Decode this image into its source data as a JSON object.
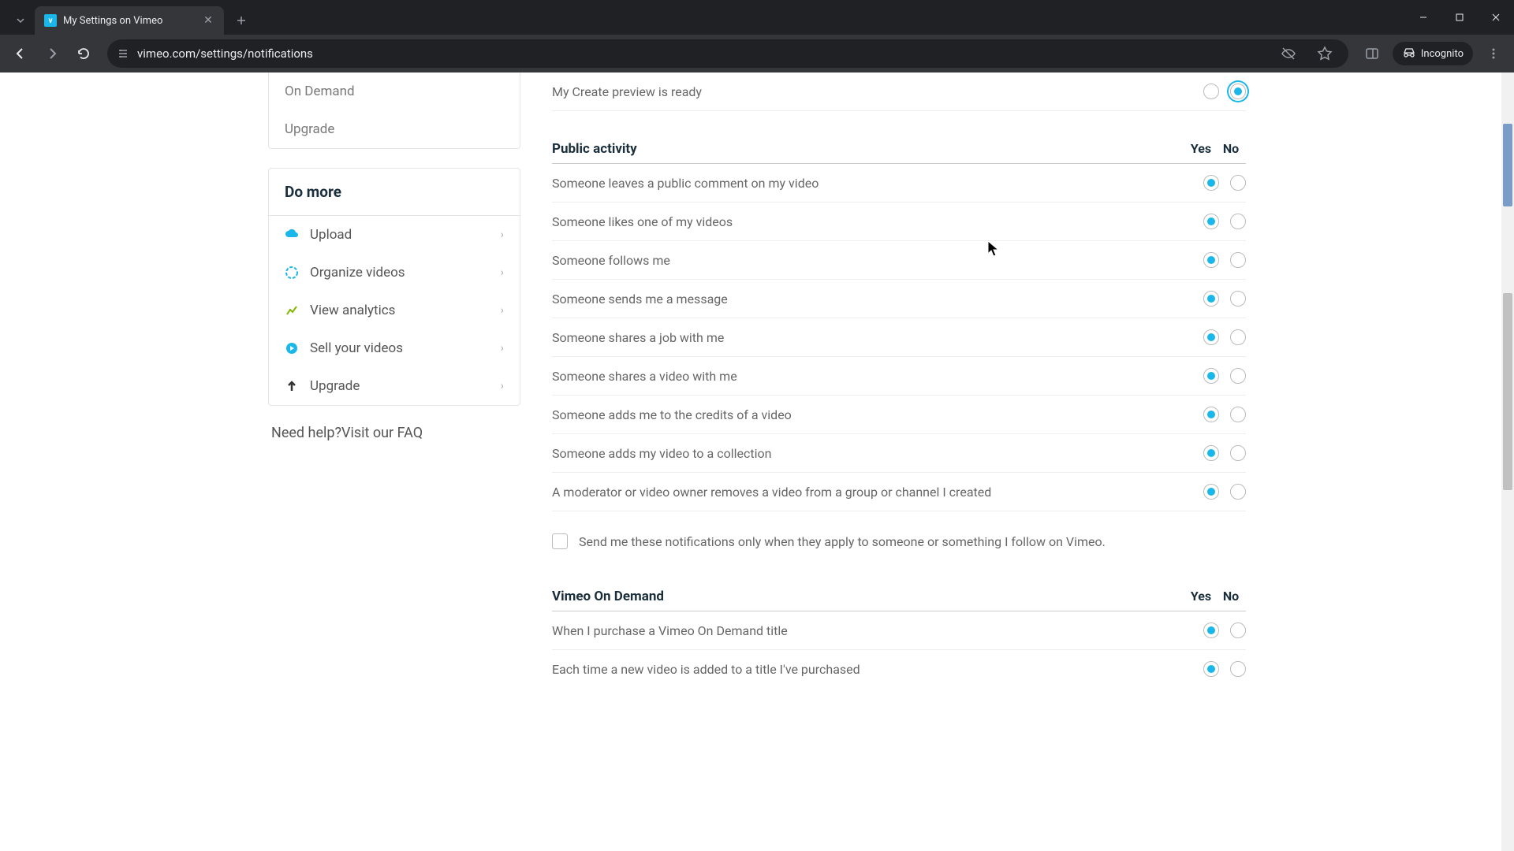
{
  "browser": {
    "tab_title": "My Settings on Vimeo",
    "url_display": "vimeo.com/settings/notifications",
    "incognito_label": "Incognito"
  },
  "sidebar": {
    "top_links": [
      "On Demand",
      "Upgrade"
    ],
    "do_more_header": "Do more",
    "actions": [
      {
        "label": "Upload",
        "icon": "cloud"
      },
      {
        "label": "Organize videos",
        "icon": "organize"
      },
      {
        "label": "View analytics",
        "icon": "analytics"
      },
      {
        "label": "Sell your videos",
        "icon": "sell"
      },
      {
        "label": "Upgrade",
        "icon": "upgrade"
      }
    ],
    "help_text": "Need help?Visit our FAQ"
  },
  "main": {
    "top_row": {
      "label": "My Create preview is ready",
      "selected": "no_ring"
    },
    "sections": [
      {
        "title": "Public activity",
        "yes_label": "Yes",
        "no_label": "No",
        "rows": [
          {
            "label": "Someone leaves a public comment on my video",
            "selected": "yes"
          },
          {
            "label": "Someone likes one of my videos",
            "selected": "yes"
          },
          {
            "label": "Someone follows me",
            "selected": "yes"
          },
          {
            "label": "Someone sends me a message",
            "selected": "yes"
          },
          {
            "label": "Someone shares a job with me",
            "selected": "yes"
          },
          {
            "label": "Someone shares a video with me",
            "selected": "yes"
          },
          {
            "label": "Someone adds me to the credits of a video",
            "selected": "yes"
          },
          {
            "label": "Someone adds my video to a collection",
            "selected": "yes"
          },
          {
            "label": "A moderator or video owner removes a video from a group or channel I created",
            "selected": "yes"
          }
        ],
        "checkbox_label": "Send me these notifications only when they apply to someone or something I follow on Vimeo."
      },
      {
        "title": "Vimeo On Demand",
        "yes_label": "Yes",
        "no_label": "No",
        "rows": [
          {
            "label": "When I purchase a Vimeo On Demand title",
            "selected": "yes"
          },
          {
            "label": "Each time a new video is added to a title I've purchased",
            "selected": "yes"
          }
        ]
      }
    ]
  }
}
